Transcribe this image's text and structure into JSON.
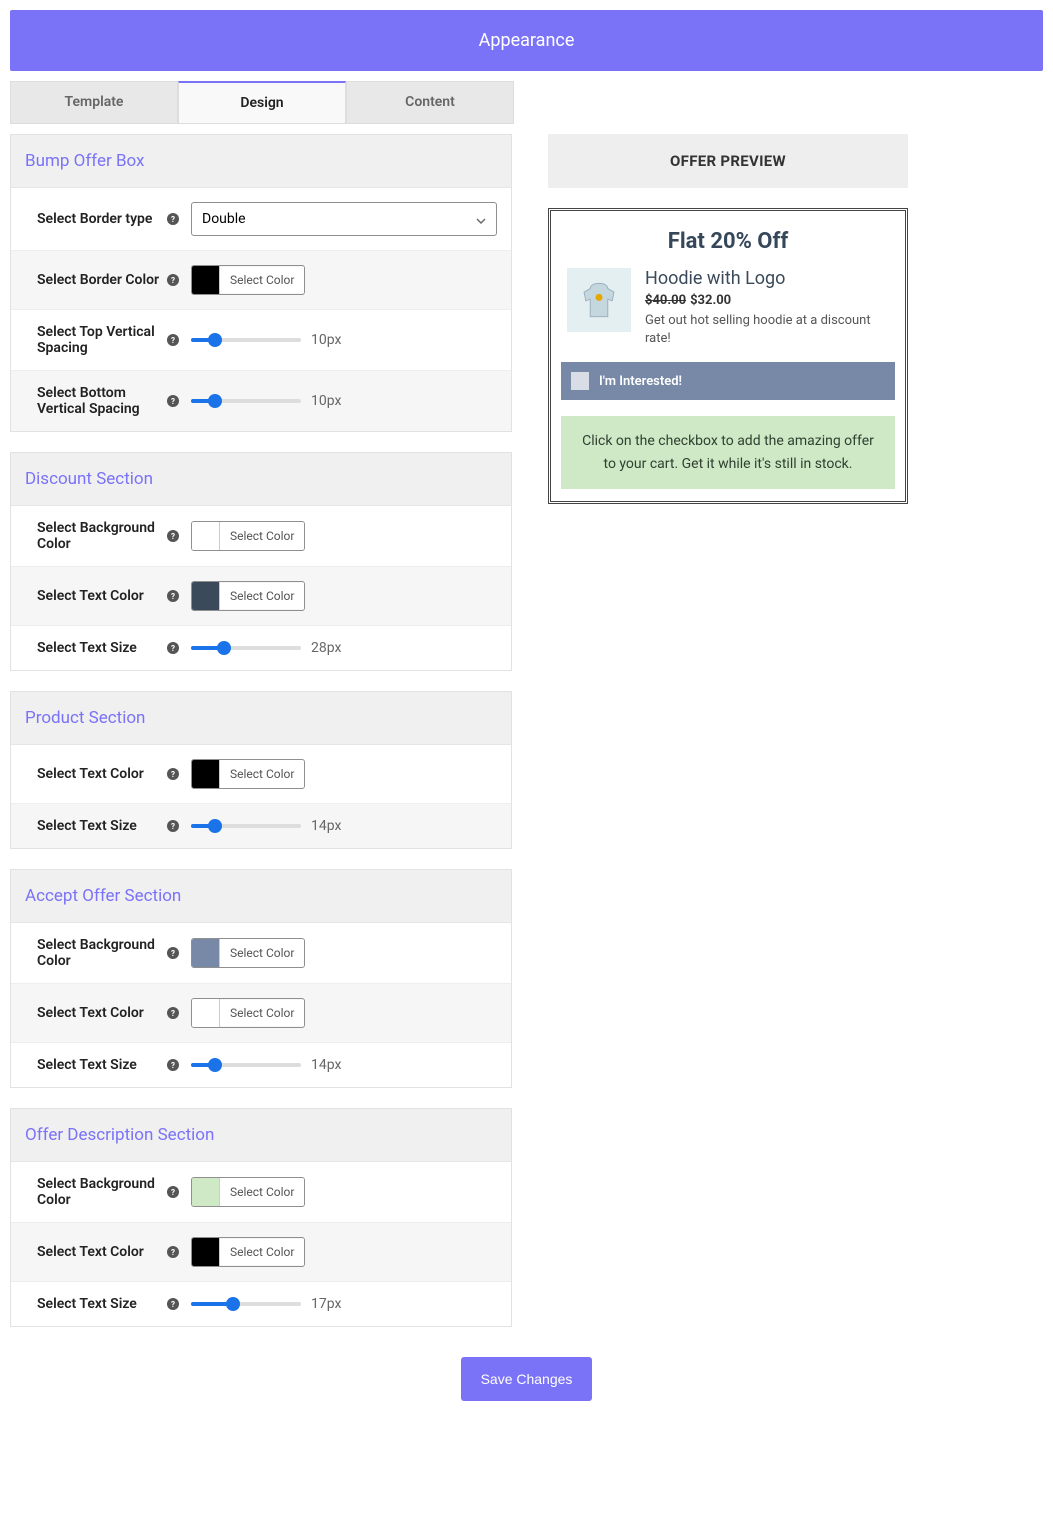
{
  "header": {
    "title": "Appearance"
  },
  "tabs": [
    {
      "label": "Template",
      "active": false
    },
    {
      "label": "Design",
      "active": true
    },
    {
      "label": "Content",
      "active": false
    }
  ],
  "color_button_label": "Select Color",
  "sections": {
    "bump": {
      "title": "Bump Offer Box",
      "rows": {
        "border_type": {
          "label": "Select Border type",
          "value": "Double"
        },
        "border_color": {
          "label": "Select Border Color",
          "swatch": "#000000"
        },
        "top_spacing": {
          "label": "Select Top Vertical Spacing",
          "value": "10px",
          "pct": 22
        },
        "bottom_spacing": {
          "label": "Select Bottom Vertical Spacing",
          "value": "10px",
          "pct": 22
        }
      }
    },
    "discount": {
      "title": "Discount Section",
      "rows": {
        "bg": {
          "label": "Select Background Color",
          "swatch": "#ffffff"
        },
        "text_color": {
          "label": "Select Text Color",
          "swatch": "#3b4a5a"
        },
        "text_size": {
          "label": "Select Text Size",
          "value": "28px",
          "pct": 30
        }
      }
    },
    "product": {
      "title": "Product Section",
      "rows": {
        "text_color": {
          "label": "Select Text Color",
          "swatch": "#000000"
        },
        "text_size": {
          "label": "Select Text Size",
          "value": "14px",
          "pct": 22
        }
      }
    },
    "accept": {
      "title": "Accept Offer Section",
      "rows": {
        "bg": {
          "label": "Select Background Color",
          "swatch": "#7789a6"
        },
        "text_color": {
          "label": "Select Text Color",
          "swatch": "#ffffff"
        },
        "text_size": {
          "label": "Select Text Size",
          "value": "14px",
          "pct": 22
        }
      }
    },
    "offer_desc": {
      "title": "Offer Description Section",
      "rows": {
        "bg": {
          "label": "Select Background Color",
          "swatch": "#cfe8c6"
        },
        "text_color": {
          "label": "Select Text Color",
          "swatch": "#000000"
        },
        "text_size": {
          "label": "Select Text Size",
          "value": "17px",
          "pct": 38
        }
      }
    }
  },
  "preview": {
    "header": "OFFER PREVIEW",
    "title": "Flat 20% Off",
    "product_name": "Hoodie with Logo",
    "price_old": "$40.00",
    "price_new": "$32.00",
    "desc": "Get out hot selling hoodie at a discount rate!",
    "accept_text": "I'm Interested!",
    "offer_desc": "Click on the checkbox to add the amazing offer to your cart. Get it while it's still in stock."
  },
  "save_label": "Save Changes"
}
